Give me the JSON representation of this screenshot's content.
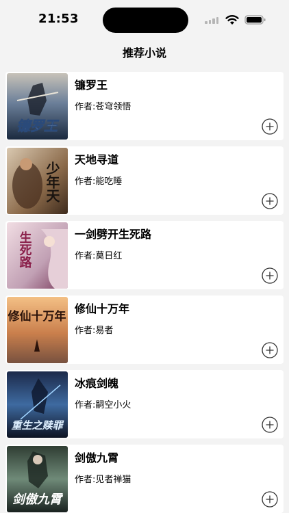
{
  "status_bar": {
    "time": "21:53"
  },
  "nav": {
    "title": "推荐小说"
  },
  "books": [
    {
      "title": "镰罗王",
      "author": "作者:苍穹领悟",
      "cover_text": "镰罗王",
      "cover_colors": [
        "#1b2a3f",
        "#6b7f99",
        "#c7c2b8"
      ]
    },
    {
      "title": "天地寻道",
      "author": "作者:能吃睡",
      "cover_text": "少年天",
      "cover_colors": [
        "#d9c8b0",
        "#8b6a4a",
        "#3d2a1c"
      ]
    },
    {
      "title": "一剑劈开生死路",
      "author": "作者:莫日红",
      "cover_text": "生死路",
      "cover_colors": [
        "#f1dde3",
        "#c1a0b4",
        "#7a3b5c"
      ]
    },
    {
      "title": "修仙十万年",
      "author": "作者:易者",
      "cover_text": "修仙十万年",
      "cover_colors": [
        "#f0b06a",
        "#b85a1e",
        "#4a1d0d"
      ]
    },
    {
      "title": "冰痕剑魄",
      "author": "作者:嗣空小火",
      "cover_text": "重生之赎罪",
      "cover_colors": [
        "#1c2a4a",
        "#3e6aa0",
        "#0d1322"
      ]
    },
    {
      "title": "剑傲九霄",
      "author": "作者:见者禅猫",
      "cover_text": "剑傲九霄",
      "cover_colors": [
        "#2f3d33",
        "#6f8a78",
        "#1a2220"
      ]
    }
  ]
}
